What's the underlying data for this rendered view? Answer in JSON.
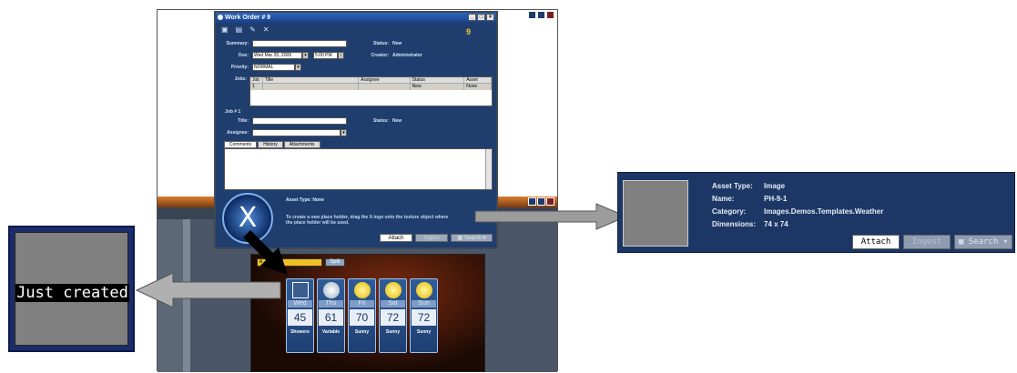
{
  "work_order": {
    "window_title": "Work Order # 9",
    "number": "9",
    "summary_label": "Summary:",
    "due_label": "Due:",
    "due_date": "Wed Mar 25, 2009",
    "due_time": "5:00 PM",
    "priority_label": "Priority:",
    "priority_value": "NORMAL",
    "status_label": "Status:",
    "status_value": "New",
    "creator_label": "Creator:",
    "creator_value": "Administrator",
    "jobs_label": "Jobs:",
    "jobs_columns": [
      "Job",
      "Title",
      "Assignee",
      "Status",
      "Asset"
    ],
    "jobs_rows": [
      [
        "1",
        "",
        "",
        "New",
        "None"
      ]
    ],
    "job_header": "Job # 1",
    "job_title_label": "Title:",
    "job_status_label": "Status:",
    "job_status_value": "New",
    "assignee_label": "Assignee:",
    "tabs": [
      "Comments",
      "History",
      "Attachments"
    ],
    "asset_type_label": "Asset Type: None",
    "hint": "To create a new place holder, drag the X-logo onto the texture object where the place holder will be used.",
    "buttons": {
      "attach": "Attach",
      "ingest": "Ingest",
      "search": "Search"
    }
  },
  "forecast": {
    "toolbar_dropdown": "e",
    "toolbar_button": "Split",
    "days": [
      {
        "day": "Wed",
        "temp": "45",
        "cond": "Showers"
      },
      {
        "day": "Thu",
        "temp": "61",
        "cond": "Variable"
      },
      {
        "day": "Fri",
        "temp": "70",
        "cond": "Sunny"
      },
      {
        "day": "Sat",
        "temp": "72",
        "cond": "Sunny"
      },
      {
        "day": "Sun",
        "temp": "72",
        "cond": "Sunny"
      }
    ]
  },
  "left_callout": {
    "label": "Just created"
  },
  "right_callout": {
    "asset_type_label": "Asset Type:",
    "asset_type_value": "Image",
    "name_label": "Name:",
    "name_value": "PH-9-1",
    "category_label": "Category:",
    "category_value": "Images.Demos.Templates.Weather",
    "dimensions_label": "Dimensions:",
    "dimensions_value": "74 x 74",
    "buttons": {
      "attach": "Attach",
      "ingest": "Ingest",
      "search": "Search"
    }
  }
}
